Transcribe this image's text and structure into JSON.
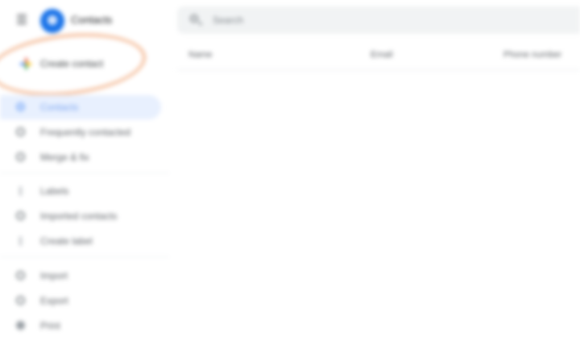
{
  "app": {
    "title": "Contacts"
  },
  "create": {
    "label": "Create contact"
  },
  "nav": {
    "primary": [
      {
        "label": "Contacts",
        "active": true,
        "icon": "person-icon"
      },
      {
        "label": "Frequently contacted",
        "active": false,
        "icon": "history-icon"
      },
      {
        "label": "Merge & fix",
        "active": false,
        "icon": "merge-icon"
      }
    ],
    "labels": [
      {
        "label": "Labels",
        "icon": "chevron-icon"
      },
      {
        "label": "Imported contacts",
        "icon": "label-icon"
      },
      {
        "label": "Create label",
        "icon": "add-icon"
      }
    ],
    "tools": [
      {
        "label": "Import",
        "icon": "import-icon"
      },
      {
        "label": "Export",
        "icon": "export-icon"
      },
      {
        "label": "Print",
        "icon": "print-icon"
      }
    ]
  },
  "search": {
    "placeholder": "Search"
  },
  "table": {
    "headers": [
      "Name",
      "Email",
      "Phone number"
    ]
  },
  "colors": {
    "accent": "#1a73e8",
    "active_bg": "#e8f0fe",
    "highlight": "#f6c7a8"
  }
}
